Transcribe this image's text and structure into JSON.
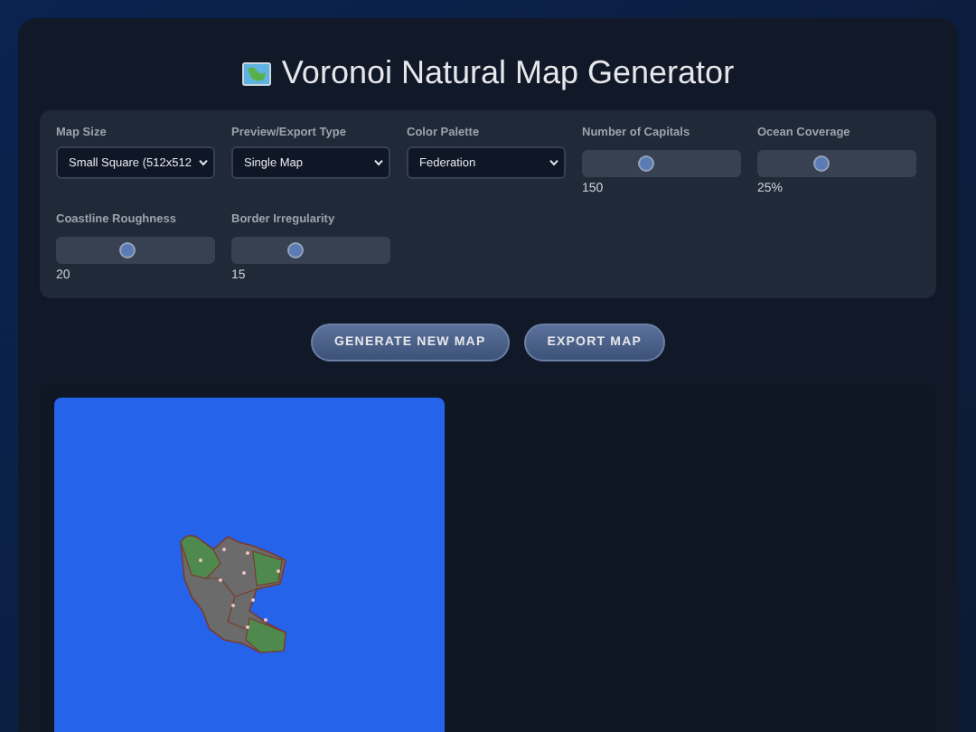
{
  "title": "Voronoi Natural Map Generator",
  "controls": [
    {
      "kind": "select",
      "label": "Map Size",
      "value": "Small Square (512x512"
    },
    {
      "kind": "select",
      "label": "Preview/Export Type",
      "value": "Single Map"
    },
    {
      "kind": "select",
      "label": "Color Palette",
      "value": "Federation"
    },
    {
      "kind": "slider",
      "label": "Number of Capitals",
      "level": 0.4,
      "reading": "150"
    },
    {
      "kind": "slider",
      "label": "Ocean Coverage",
      "level": 0.4,
      "reading": "25%"
    },
    {
      "kind": "slider",
      "label": "Coastline Roughness",
      "level": 0.45,
      "reading": "20"
    },
    {
      "kind": "slider",
      "label": "Border Irregularity",
      "level": 0.4,
      "reading": "15"
    }
  ],
  "buttons": [
    "GENERATE NEW MAP",
    "EXPORT MAP"
  ]
}
